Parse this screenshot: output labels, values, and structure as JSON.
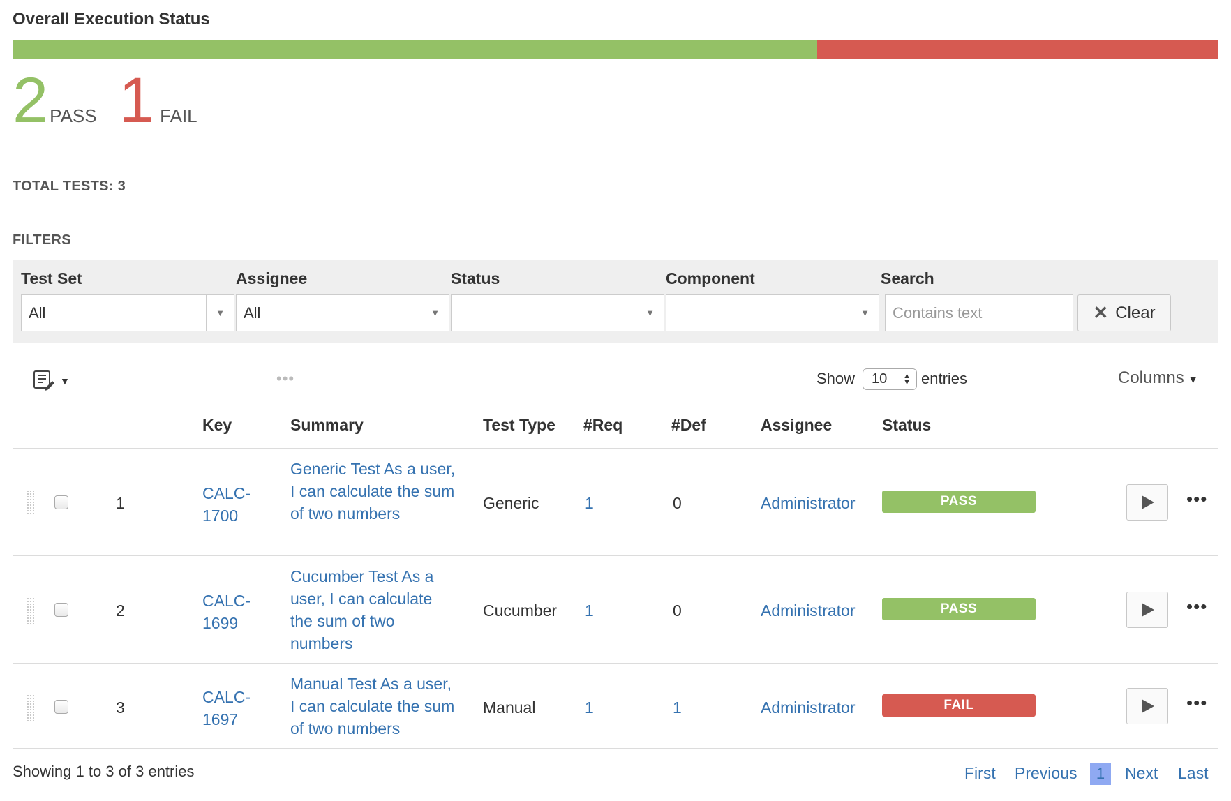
{
  "header": {
    "title": "Overall Execution Status",
    "pass_color": "#94c166",
    "fail_color": "#d65a51",
    "pass_fraction": 0.667,
    "fail_fraction": 0.333
  },
  "summary_counts": {
    "pass_count": "2",
    "pass_label": "PASS",
    "fail_count": "1",
    "fail_label": "FAIL"
  },
  "total_tests": "TOTAL TESTS: 3",
  "filters": {
    "heading": "FILTERS",
    "test_set": {
      "label": "Test Set",
      "value": "All"
    },
    "assignee": {
      "label": "Assignee",
      "value": "All"
    },
    "status": {
      "label": "Status",
      "value": ""
    },
    "component": {
      "label": "Component",
      "value": ""
    },
    "search": {
      "label": "Search",
      "placeholder": "Contains text",
      "value": ""
    },
    "clear_label": "Clear"
  },
  "toolbar": {
    "show_label": "Show",
    "page_size": "10",
    "entries_label": "entries",
    "columns_label": "Columns"
  },
  "table": {
    "headers": {
      "key": "Key",
      "summary": "Summary",
      "test_type": "Test Type",
      "req": "#Req",
      "def": "#Def",
      "assignee": "Assignee",
      "status": "Status"
    },
    "rows": [
      {
        "index": "1",
        "key_line1": "CALC-",
        "key_line2": "1700",
        "summary": "Generic Test As a user, I can calculate the sum of two numbers",
        "test_type": "Generic",
        "req": "1",
        "def": "0",
        "assignee": "Administrator",
        "status": "PASS"
      },
      {
        "index": "2",
        "key_line1": "CALC-",
        "key_line2": "1699",
        "summary": "Cucumber Test As a user, I can calculate the sum of two numbers",
        "test_type": "Cucumber",
        "req": "1",
        "def": "0",
        "assignee": "Administrator",
        "status": "PASS"
      },
      {
        "index": "3",
        "key_line1": "CALC-",
        "key_line2": "1697",
        "summary": "Manual Test As a user, I can calculate the sum of two numbers",
        "test_type": "Manual",
        "req": "1",
        "def": "1",
        "assignee": "Administrator",
        "status": "FAIL"
      }
    ]
  },
  "footer": {
    "showing": "Showing 1 to 3 of 3 entries",
    "first": "First",
    "previous": "Previous",
    "current_page": "1",
    "next": "Next",
    "last": "Last"
  }
}
